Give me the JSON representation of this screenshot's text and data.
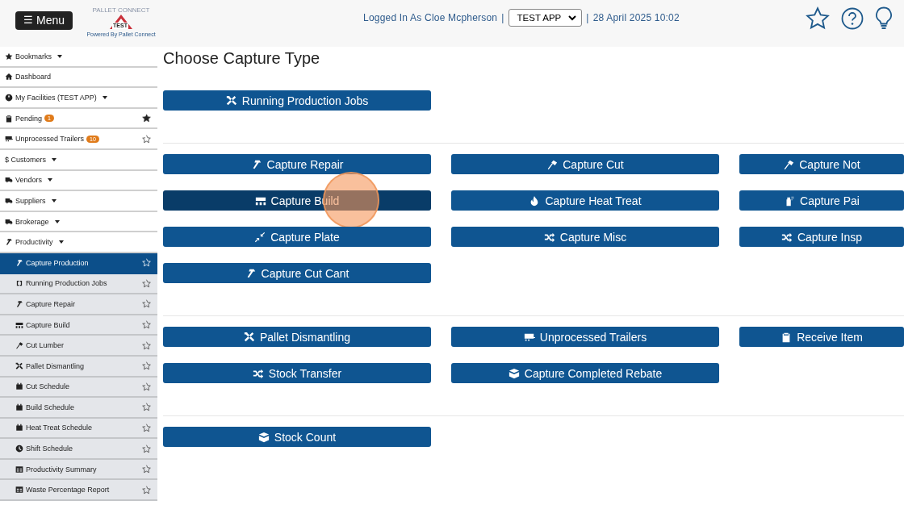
{
  "header": {
    "menu_icon": "☰",
    "menu_button": "Menu",
    "logo": {
      "top_text": "PALLET CONNECT",
      "badge_text": "TEST",
      "tagline": "Powered By Pallet Connect"
    },
    "user_text": "Logged In As Cloe Mcpherson",
    "separator_1": "|",
    "app_select": "TEST APP",
    "separator_2": "|",
    "datetime": "28 April 2025 10:02"
  },
  "sidebar": {
    "items": [
      {
        "label": "Bookmarks",
        "dropdown": true,
        "selected": false
      },
      {
        "label": "Dashboard",
        "dropdown": false,
        "selected": false
      },
      {
        "label": "My Facilities (TEST APP)",
        "dropdown": true,
        "selected": false
      },
      {
        "label": "Pending",
        "badge": "1",
        "dropdown": false,
        "starred": true,
        "selected": false
      },
      {
        "label": "Unprocessed Trailers",
        "badge": "10",
        "dropdown": false,
        "starred": false,
        "selected": false
      },
      {
        "label": "$ Customers",
        "dropdown": true,
        "selected": false
      },
      {
        "label": "Vendors",
        "dropdown": true,
        "selected": false
      },
      {
        "label": "Suppliers",
        "dropdown": true,
        "selected": false
      },
      {
        "label": "Brokerage",
        "dropdown": true,
        "selected": false
      },
      {
        "label": "Productivity",
        "dropdown": true,
        "selected": false,
        "children": [
          {
            "label": "Capture Production",
            "starred": false,
            "selected": true
          },
          {
            "label": "Running Production Jobs",
            "starred": false,
            "selected": false
          },
          {
            "label": "Capture Repair",
            "starred": false,
            "selected": false
          },
          {
            "label": "Capture Build",
            "starred": false,
            "selected": false
          },
          {
            "label": "Cut Lumber",
            "starred": false,
            "selected": false
          },
          {
            "label": "Pallet Dismantling",
            "starred": false,
            "selected": false
          },
          {
            "label": "Cut Schedule",
            "starred": false,
            "selected": false
          },
          {
            "label": "Build Schedule",
            "starred": false,
            "selected": false
          },
          {
            "label": "Heat Treat Schedule",
            "starred": false,
            "selected": false
          },
          {
            "label": "Shift Schedule",
            "starred": false,
            "selected": false
          },
          {
            "label": "Productivity Summary",
            "starred": false,
            "selected": false
          },
          {
            "label": "Waste Percentage Report",
            "starred": false,
            "selected": false
          }
        ]
      }
    ]
  },
  "page_title": "Choose Capture Type",
  "sections": [
    {
      "buttons": [
        {
          "label": "Running Production Jobs",
          "hovered": false
        }
      ]
    },
    {
      "buttons": [
        {
          "label": "Capture Repair",
          "hovered": false
        },
        {
          "label": "Capture Cut",
          "hovered": false
        },
        {
          "label": "Capture Not",
          "hovered": false
        },
        {
          "label": "Capture Build",
          "hovered": true
        },
        {
          "label": "Capture Heat Treat",
          "hovered": false
        },
        {
          "label": "Capture Pai",
          "hovered": false
        },
        {
          "label": "Capture Plate",
          "hovered": false
        },
        {
          "label": "Capture Misc",
          "hovered": false
        },
        {
          "label": "Capture Insp",
          "hovered": false
        },
        {
          "label": "Capture Cut Cant",
          "hovered": false
        }
      ]
    },
    {
      "buttons": [
        {
          "label": "Pallet Dismantling",
          "hovered": false
        },
        {
          "label": "Unprocessed Trailers",
          "hovered": false
        },
        {
          "label": "Receive Item",
          "hovered": false
        },
        {
          "label": "Stock Transfer",
          "hovered": false
        },
        {
          "label": "Capture Completed Rebate",
          "hovered": false
        }
      ]
    },
    {
      "buttons": [
        {
          "label": "Stock Count",
          "hovered": false
        }
      ]
    }
  ]
}
